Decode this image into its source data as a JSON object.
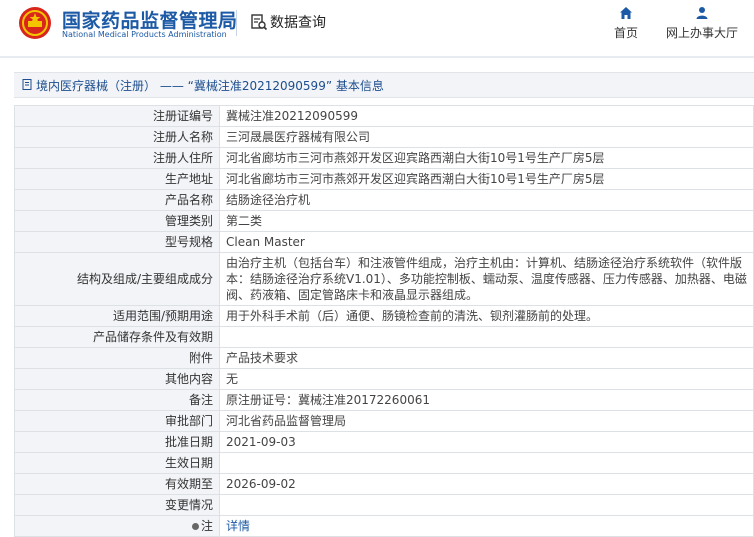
{
  "header": {
    "brand_cn": "国家药品监督管理局",
    "brand_en": "National Medical Products Administration",
    "query_label": "数据查询",
    "nav": {
      "home": "首页",
      "office": "网上办事大厅"
    }
  },
  "breadcrumb": {
    "text": "境内医疗器械（注册） —— “冀械注准20212090599” 基本信息"
  },
  "rows": [
    {
      "label": "注册证编号",
      "value": "冀械注准20212090599"
    },
    {
      "label": "注册人名称",
      "value": "三河晟晨医疗器械有限公司"
    },
    {
      "label": "注册人住所",
      "value": "河北省廊坊市三河市燕郊开发区迎宾路西潮白大街10号1号生产厂房5层"
    },
    {
      "label": "生产地址",
      "value": "河北省廊坊市三河市燕郊开发区迎宾路西潮白大街10号1号生产厂房5层"
    },
    {
      "label": "产品名称",
      "value": "结肠途径治疗机"
    },
    {
      "label": "管理类别",
      "value": "第二类"
    },
    {
      "label": "型号规格",
      "value": "Clean Master"
    },
    {
      "label": "结构及组成/主要组成成分",
      "value": "由治疗主机（包括台车）和注液管件组成，治疗主机由：计算机、结肠途径治疗系统软件（软件版本：结肠途径治疗系统V1.01）、多功能控制板、蠕动泵、温度传感器、压力传感器、加热器、电磁阀、药液箱、固定管路床卡和液晶显示器组成。"
    },
    {
      "label": "适用范围/预期用途",
      "value": "用于外科手术前（后）通便、肠镜检查前的清洗、钡剂灌肠前的处理。"
    },
    {
      "label": "产品储存条件及有效期",
      "value": ""
    },
    {
      "label": "附件",
      "value": "产品技术要求"
    },
    {
      "label": "其他内容",
      "value": "无"
    },
    {
      "label": "备注",
      "value": "原注册证号：冀械注准20172260061"
    },
    {
      "label": "审批部门",
      "value": "河北省药品监督管理局"
    },
    {
      "label": "批准日期",
      "value": "2021-09-03"
    },
    {
      "label": "生效日期",
      "value": ""
    },
    {
      "label": "有效期至",
      "value": "2026-09-02"
    },
    {
      "label": "变更情况",
      "value": ""
    },
    {
      "label": "注",
      "value": "详情"
    }
  ]
}
